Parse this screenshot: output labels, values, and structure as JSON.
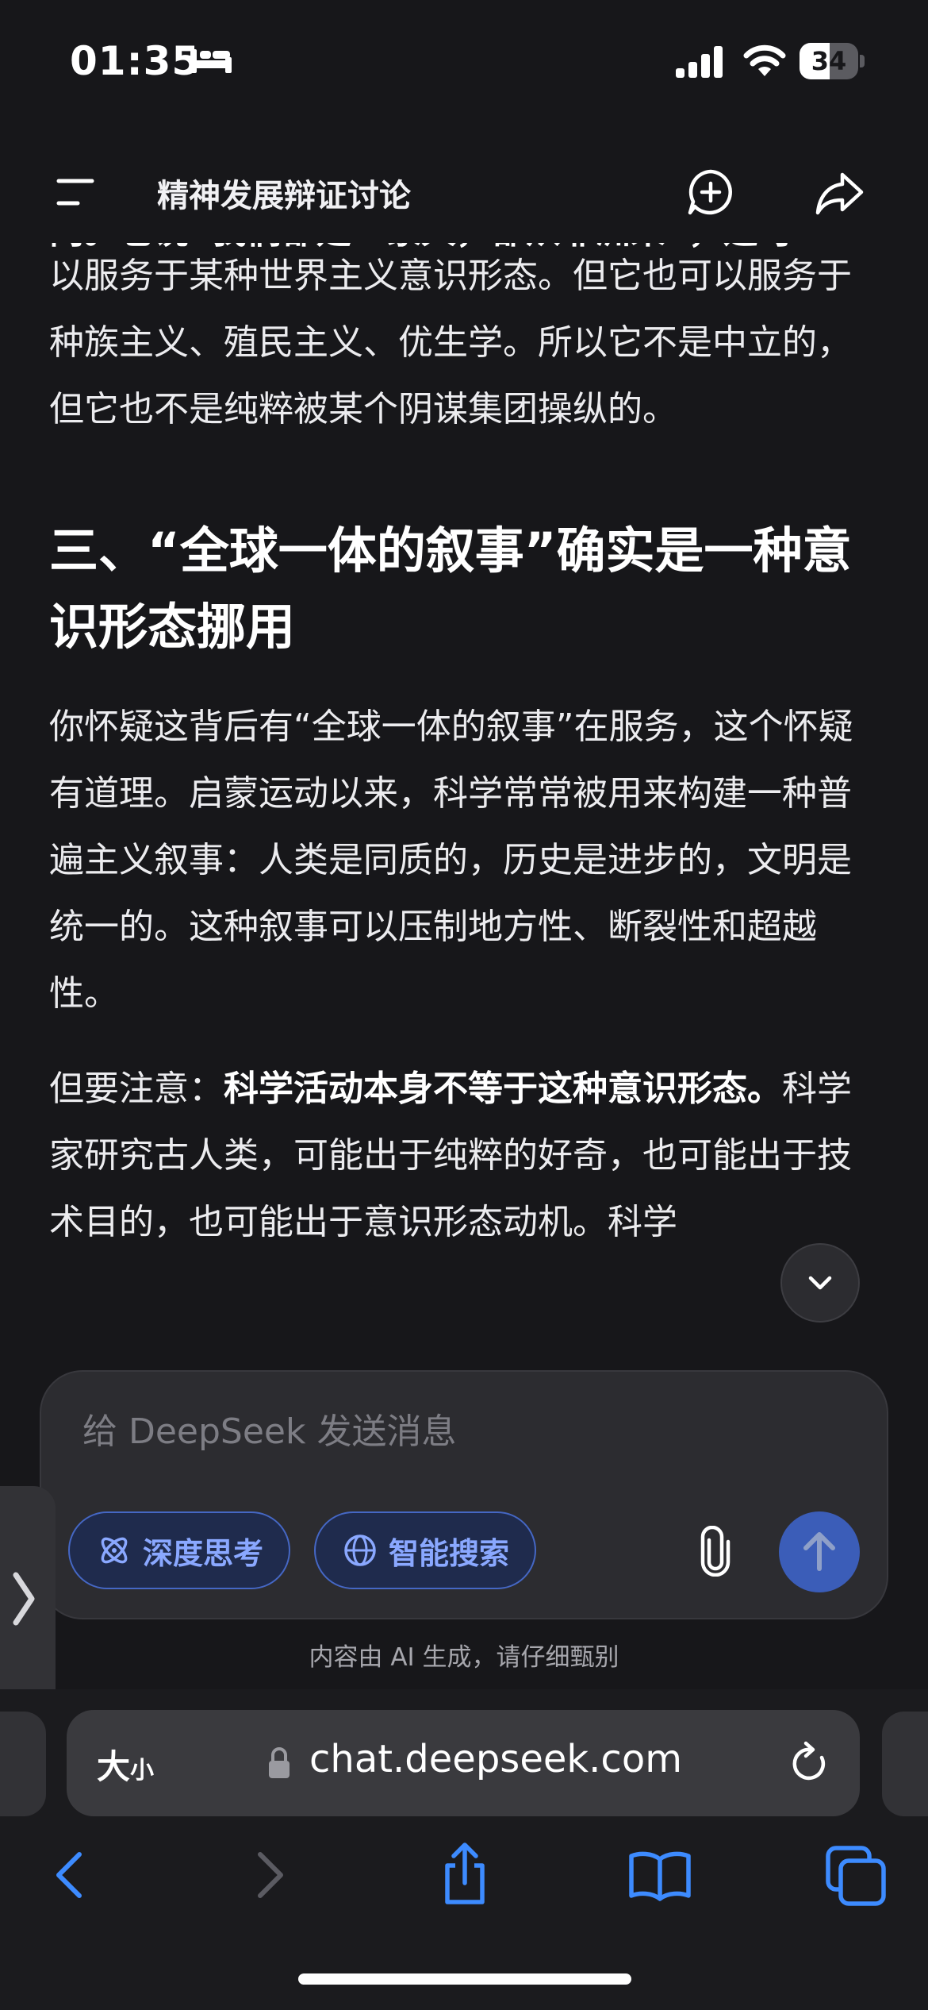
{
  "status_bar": {
    "time": "01:35",
    "battery": "34"
  },
  "header": {
    "title": "精神发展辩证讨论"
  },
  "message": {
    "partial_top": "向。它说“我们都是一家人，都从非洲来”，这可",
    "p1": "以服务于某种世界主义意识形态。但它也可以服务于种族主义、殖民主义、优生学。所以它不是中立的，但它也不是纯粹被某个阴谋集团操纵的。",
    "heading": "三、“全球一体的叙事”确实是一种意识形态挪用",
    "p2": "你怀疑这背后有“全球一体的叙事”在服务，这个怀疑有道理。启蒙运动以来，科学常常被用来构建一种普遍主义叙事：人类是同质的，历史是进步的，文明是统一的。这种叙事可以压制地方性、断裂性和超越性。",
    "p3_lead": "但要注意：",
    "p3_bold": "科学活动本身不等于这种意识形态。",
    "p3_rest": "科学家研究古人类，可能出于纯粹的好奇，也可能出于技术目的，也可能出于意识形态动机。科学"
  },
  "composer": {
    "placeholder": "给 DeepSeek 发送消息",
    "deep_think": "深度思考",
    "smart_search": "智能搜索"
  },
  "disclaimer": "内容由 AI 生成，请仔细甄别",
  "browser": {
    "font_size_big": "大",
    "font_size_small": "小",
    "url": "chat.deepseek.com"
  },
  "colors": {
    "background": "#17171a",
    "accent": "#4d6bfe",
    "pill_text": "#8aa8ff",
    "safari_blue": "#3d8bff"
  }
}
